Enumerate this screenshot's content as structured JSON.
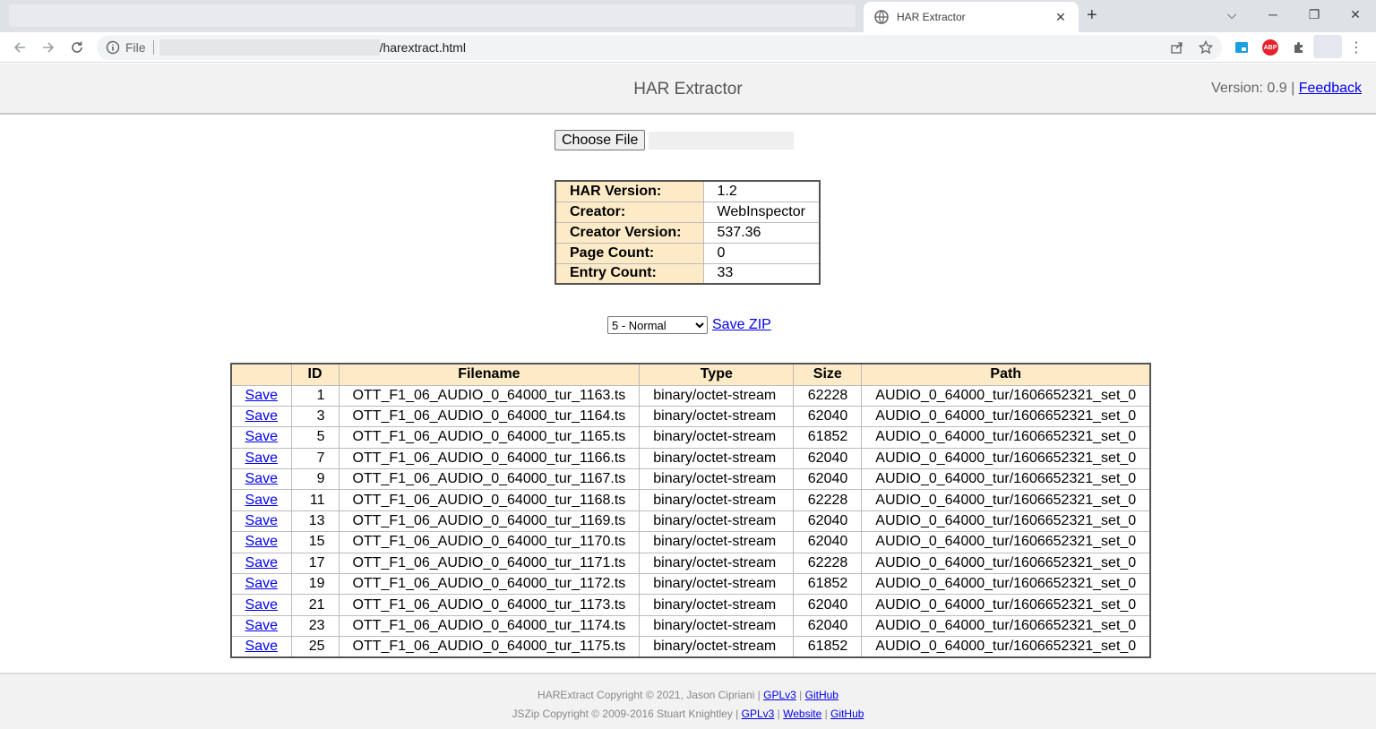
{
  "browser": {
    "tab_title": "HAR Extractor",
    "address_scheme": "File",
    "address_path": "/harextract.html"
  },
  "header": {
    "title": "HAR Extractor",
    "version_text": "Version: 0.9",
    "separator": "|",
    "feedback_label": "Feedback"
  },
  "file_input": {
    "button_label": "Choose File"
  },
  "har_info": [
    {
      "label": "HAR Version:",
      "value": "1.2"
    },
    {
      "label": "Creator:",
      "value": "WebInspector"
    },
    {
      "label": "Creator Version:",
      "value": "537.36"
    },
    {
      "label": "Page Count:",
      "value": "0"
    },
    {
      "label": "Entry Count:",
      "value": "33"
    }
  ],
  "zip": {
    "compression_selected": "5 - Normal",
    "save_zip_label": "Save ZIP"
  },
  "entries": {
    "columns": [
      "",
      "ID",
      "Filename",
      "Type",
      "Size",
      "Path"
    ],
    "save_label": "Save",
    "rows": [
      {
        "id": "1",
        "filename": "OTT_F1_06_AUDIO_0_64000_tur_1163.ts",
        "type": "binary/octet-stream",
        "size": "62228",
        "path": "AUDIO_0_64000_tur/1606652321_set_0"
      },
      {
        "id": "3",
        "filename": "OTT_F1_06_AUDIO_0_64000_tur_1164.ts",
        "type": "binary/octet-stream",
        "size": "62040",
        "path": "AUDIO_0_64000_tur/1606652321_set_0"
      },
      {
        "id": "5",
        "filename": "OTT_F1_06_AUDIO_0_64000_tur_1165.ts",
        "type": "binary/octet-stream",
        "size": "61852",
        "path": "AUDIO_0_64000_tur/1606652321_set_0"
      },
      {
        "id": "7",
        "filename": "OTT_F1_06_AUDIO_0_64000_tur_1166.ts",
        "type": "binary/octet-stream",
        "size": "62040",
        "path": "AUDIO_0_64000_tur/1606652321_set_0"
      },
      {
        "id": "9",
        "filename": "OTT_F1_06_AUDIO_0_64000_tur_1167.ts",
        "type": "binary/octet-stream",
        "size": "62040",
        "path": "AUDIO_0_64000_tur/1606652321_set_0"
      },
      {
        "id": "11",
        "filename": "OTT_F1_06_AUDIO_0_64000_tur_1168.ts",
        "type": "binary/octet-stream",
        "size": "62228",
        "path": "AUDIO_0_64000_tur/1606652321_set_0"
      },
      {
        "id": "13",
        "filename": "OTT_F1_06_AUDIO_0_64000_tur_1169.ts",
        "type": "binary/octet-stream",
        "size": "62040",
        "path": "AUDIO_0_64000_tur/1606652321_set_0"
      },
      {
        "id": "15",
        "filename": "OTT_F1_06_AUDIO_0_64000_tur_1170.ts",
        "type": "binary/octet-stream",
        "size": "62040",
        "path": "AUDIO_0_64000_tur/1606652321_set_0"
      },
      {
        "id": "17",
        "filename": "OTT_F1_06_AUDIO_0_64000_tur_1171.ts",
        "type": "binary/octet-stream",
        "size": "62228",
        "path": "AUDIO_0_64000_tur/1606652321_set_0"
      },
      {
        "id": "19",
        "filename": "OTT_F1_06_AUDIO_0_64000_tur_1172.ts",
        "type": "binary/octet-stream",
        "size": "61852",
        "path": "AUDIO_0_64000_tur/1606652321_set_0"
      },
      {
        "id": "21",
        "filename": "OTT_F1_06_AUDIO_0_64000_tur_1173.ts",
        "type": "binary/octet-stream",
        "size": "62040",
        "path": "AUDIO_0_64000_tur/1606652321_set_0"
      },
      {
        "id": "23",
        "filename": "OTT_F1_06_AUDIO_0_64000_tur_1174.ts",
        "type": "binary/octet-stream",
        "size": "62040",
        "path": "AUDIO_0_64000_tur/1606652321_set_0"
      },
      {
        "id": "25",
        "filename": "OTT_F1_06_AUDIO_0_64000_tur_1175.ts",
        "type": "binary/octet-stream",
        "size": "61852",
        "path": "AUDIO_0_64000_tur/1606652321_set_0"
      }
    ]
  },
  "footer": {
    "line1_text": "HARExtract Copyright © 2021, Jason Cipriani |",
    "line1_links": [
      "GPLv3",
      "GitHub"
    ],
    "line2_text": "JSZip Copyright © 2009-2016 Stuart Knightley |",
    "line2_links": [
      "GPLv3",
      "Website",
      "GitHub"
    ],
    "separator": "|"
  },
  "icons": {
    "back": "arrow-left-icon",
    "forward": "arrow-right-icon",
    "reload": "reload-icon",
    "info": "info-icon",
    "share": "share-icon",
    "star": "star-icon",
    "extension": "puzzle-icon",
    "abp": "adblock-icon",
    "menu": "kebab-menu-icon"
  },
  "colors": {
    "header_bg": "#f2f2f2",
    "table_header_bg": "#fdebc8",
    "link": "#0000ee"
  }
}
